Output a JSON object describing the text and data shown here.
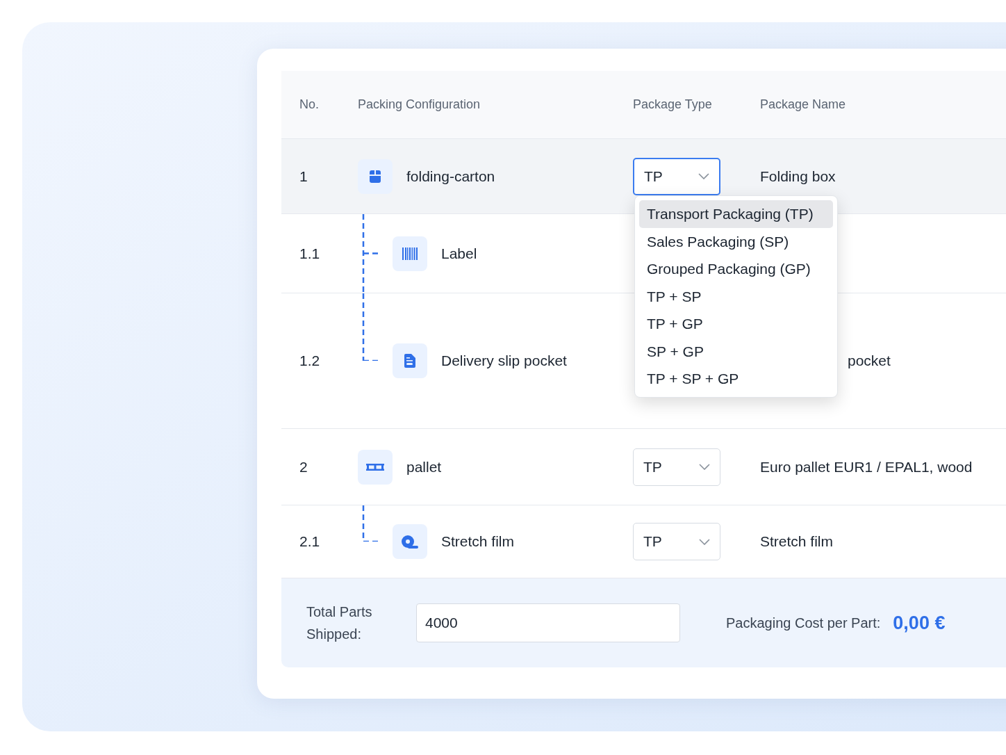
{
  "table": {
    "columns": [
      "No.",
      "Packing Configuration",
      "Package Type",
      "Package Name"
    ],
    "rows": [
      {
        "no": "1",
        "name": "folding-carton",
        "selected": true,
        "package_type": {
          "value": "TP",
          "focused": true
        },
        "package_name": "Folding box",
        "children": [
          {
            "no": "1.1",
            "name": "Label",
            "selected": false
          },
          {
            "no": "1.2",
            "name": "Delivery slip pocket",
            "selected": false,
            "package_name": "pocket"
          }
        ]
      },
      {
        "no": "2",
        "name": "pallet",
        "selected": false,
        "package_type": {
          "value": "TP",
          "focused": false
        },
        "package_name": "Euro pallet EUR1 / EPAL1, wood",
        "children": [
          {
            "no": "2.1",
            "name": "Stretch film",
            "selected": false,
            "package_type": {
              "value": "TP",
              "focused": false
            },
            "package_name": "Stretch film"
          }
        ]
      }
    ]
  },
  "dropdown": {
    "options": [
      {
        "label": "Transport Packaging (TP)",
        "selected": true
      },
      {
        "label": "Sales Packaging (SP)",
        "selected": false
      },
      {
        "label": "Grouped Packaging (GP)",
        "selected": false
      },
      {
        "label": "TP + SP",
        "selected": false
      },
      {
        "label": "TP + GP",
        "selected": false
      },
      {
        "label": "SP + GP",
        "selected": false
      },
      {
        "label": "TP + SP + GP",
        "selected": false
      }
    ]
  },
  "footer": {
    "total_label": "Total Parts Shipped:",
    "total_value": "4000",
    "cost_label": "Packaging Cost per Part:",
    "cost_value": "0,00 €"
  }
}
